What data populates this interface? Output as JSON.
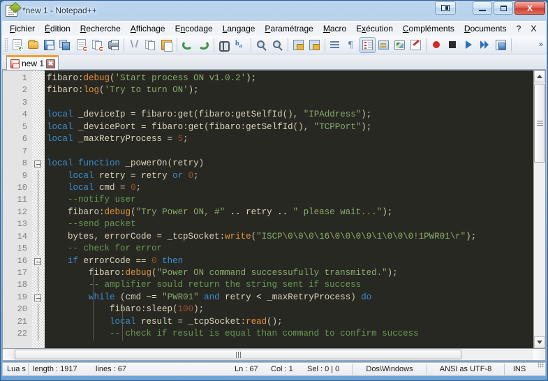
{
  "window": {
    "title": "*new  1 - Notepad++",
    "icon": "notepad-plus-plus-icon",
    "buttons": {
      "dual_view": "dual-view-icon",
      "minimize": "minimize-icon",
      "maximize": "maximize-icon",
      "close": "X"
    }
  },
  "menubar": {
    "items": [
      {
        "label": "Fichier",
        "accel": "F"
      },
      {
        "label": "Édition",
        "accel": "É"
      },
      {
        "label": "Recherche",
        "accel": "R"
      },
      {
        "label": "Affichage",
        "accel": "A"
      },
      {
        "label": "Encodage",
        "accel": "n"
      },
      {
        "label": "Langage",
        "accel": "L"
      },
      {
        "label": "Paramétrage",
        "accel": "P"
      },
      {
        "label": "Macro",
        "accel": "M"
      },
      {
        "label": "Exécution",
        "accel": "x"
      },
      {
        "label": "Compléments",
        "accel": "C"
      },
      {
        "label": "Documents",
        "accel": "D"
      },
      {
        "label": "?",
        "accel": "?"
      },
      {
        "label": "X",
        "accel": "X"
      }
    ]
  },
  "toolbar": {
    "overflow_label": "»",
    "buttons": [
      {
        "name": "new-file-icon",
        "title": "Nouveau"
      },
      {
        "name": "open-file-icon",
        "title": "Ouvrir"
      },
      {
        "name": "save-icon",
        "title": "Enregistrer"
      },
      {
        "name": "save-all-icon",
        "title": "Tout enregistrer"
      },
      {
        "name": "close-file-icon",
        "title": "Fermer"
      },
      {
        "name": "close-all-files-icon",
        "title": "Tout fermer"
      },
      {
        "name": "print-icon",
        "title": "Imprimer"
      },
      {
        "name": "cut-icon",
        "title": "Couper"
      },
      {
        "name": "copy-icon",
        "title": "Copier"
      },
      {
        "name": "paste-icon",
        "title": "Coller"
      },
      {
        "name": "undo-icon",
        "title": "Annuler"
      },
      {
        "name": "redo-icon",
        "title": "Refaire"
      },
      {
        "name": "find-icon",
        "title": "Rechercher"
      },
      {
        "name": "replace-icon",
        "title": "Remplacer"
      },
      {
        "name": "zoom-in-icon",
        "title": "Zoom avant"
      },
      {
        "name": "zoom-out-icon",
        "title": "Zoom arrière"
      },
      {
        "name": "sync-scroll-v-icon",
        "title": "Synchro verticale"
      },
      {
        "name": "sync-scroll-h-icon",
        "title": "Synchro horizontale"
      },
      {
        "name": "word-wrap-indent-icon",
        "title": "Indentation"
      },
      {
        "name": "pilcrow-icon",
        "title": "Marques de paragraphe"
      },
      {
        "name": "all-chars-icon",
        "title": "Afficher tous les caractères",
        "active": true
      },
      {
        "name": "wrap-lines-icon",
        "title": "Retour à la ligne"
      },
      {
        "name": "user-language-icon",
        "title": "Définition langage"
      },
      {
        "name": "doc-map-icon",
        "title": "Carte du document"
      },
      {
        "name": "record-macro-icon",
        "title": "Enregistrer macro"
      },
      {
        "name": "stop-macro-icon",
        "title": "Arrêter macro"
      },
      {
        "name": "play-macro-icon",
        "title": "Lancer macro"
      },
      {
        "name": "run-multi-macro-icon",
        "title": "Lancer plusieurs fois"
      },
      {
        "name": "save-macro-icon",
        "title": "Sauver macro"
      }
    ]
  },
  "tabs": [
    {
      "label": "new  1",
      "icon": "unsaved-file-icon",
      "close": "✖",
      "active": true
    }
  ],
  "editor": {
    "total_lines_visible": 22,
    "first_line": 1,
    "lines": [
      {
        "n": 1,
        "fold": "none",
        "guides": [],
        "tokens": [
          {
            "t": "fibaro",
            "c": "id"
          },
          {
            "t": ":",
            "c": "punc"
          },
          {
            "t": "debug",
            "c": "fn"
          },
          {
            "t": "(",
            "c": "punc"
          },
          {
            "t": "'Start process ON v1.0.2'",
            "c": "str"
          },
          {
            "t": ")",
            "c": "punc"
          },
          {
            "t": ";",
            "c": "punc"
          }
        ]
      },
      {
        "n": 2,
        "fold": "none",
        "guides": [],
        "tokens": [
          {
            "t": "fibaro",
            "c": "id"
          },
          {
            "t": ":",
            "c": "punc"
          },
          {
            "t": "log",
            "c": "fn"
          },
          {
            "t": "(",
            "c": "punc"
          },
          {
            "t": "'Try to turn ON'",
            "c": "str"
          },
          {
            "t": ")",
            "c": "punc"
          },
          {
            "t": ";",
            "c": "punc"
          }
        ]
      },
      {
        "n": 3,
        "fold": "none",
        "guides": [],
        "tokens": []
      },
      {
        "n": 4,
        "fold": "none",
        "guides": [],
        "tokens": [
          {
            "t": "local",
            "c": "kw"
          },
          {
            "t": " _deviceIp ",
            "c": "id"
          },
          {
            "t": "=",
            "c": "op"
          },
          {
            "t": " fibaro",
            "c": "id"
          },
          {
            "t": ":",
            "c": "punc"
          },
          {
            "t": "get",
            "c": "id"
          },
          {
            "t": "(",
            "c": "punc"
          },
          {
            "t": "fibaro",
            "c": "id"
          },
          {
            "t": ":",
            "c": "punc"
          },
          {
            "t": "getSelfId",
            "c": "id"
          },
          {
            "t": "()",
            "c": "punc"
          },
          {
            "t": ", ",
            "c": "punc"
          },
          {
            "t": "\"IPAddress\"",
            "c": "str"
          },
          {
            "t": ")",
            "c": "punc"
          },
          {
            "t": ";",
            "c": "punc"
          }
        ]
      },
      {
        "n": 5,
        "fold": "none",
        "guides": [],
        "tokens": [
          {
            "t": "local",
            "c": "kw"
          },
          {
            "t": " _devicePort ",
            "c": "id"
          },
          {
            "t": "=",
            "c": "op"
          },
          {
            "t": " fibaro",
            "c": "id"
          },
          {
            "t": ":",
            "c": "punc"
          },
          {
            "t": "get",
            "c": "id"
          },
          {
            "t": "(",
            "c": "punc"
          },
          {
            "t": "fibaro",
            "c": "id"
          },
          {
            "t": ":",
            "c": "punc"
          },
          {
            "t": "getSelfId",
            "c": "id"
          },
          {
            "t": "()",
            "c": "punc"
          },
          {
            "t": ", ",
            "c": "punc"
          },
          {
            "t": "\"TCPPort\"",
            "c": "str"
          },
          {
            "t": ")",
            "c": "punc"
          },
          {
            "t": ";",
            "c": "punc"
          }
        ]
      },
      {
        "n": 6,
        "fold": "none",
        "guides": [],
        "tokens": [
          {
            "t": "local",
            "c": "kw"
          },
          {
            "t": " _maxRetryProcess ",
            "c": "id"
          },
          {
            "t": "=",
            "c": "op"
          },
          {
            "t": " ",
            "c": "id"
          },
          {
            "t": "5",
            "c": "num"
          },
          {
            "t": ";",
            "c": "punc"
          }
        ]
      },
      {
        "n": 7,
        "fold": "none",
        "guides": [],
        "tokens": []
      },
      {
        "n": 8,
        "fold": "open",
        "guides": [],
        "tokens": [
          {
            "t": "local",
            "c": "kw"
          },
          {
            "t": " ",
            "c": "id"
          },
          {
            "t": "function",
            "c": "kw"
          },
          {
            "t": " _powerOn",
            "c": "id"
          },
          {
            "t": "(",
            "c": "punc"
          },
          {
            "t": "retry",
            "c": "id"
          },
          {
            "t": ")",
            "c": "punc"
          }
        ]
      },
      {
        "n": 9,
        "fold": "line",
        "guides": [],
        "tokens": [
          {
            "t": "    ",
            "c": "id"
          },
          {
            "t": "local",
            "c": "kw"
          },
          {
            "t": " retry ",
            "c": "id"
          },
          {
            "t": "=",
            "c": "op"
          },
          {
            "t": " retry ",
            "c": "id"
          },
          {
            "t": "or",
            "c": "kw"
          },
          {
            "t": " ",
            "c": "id"
          },
          {
            "t": "0",
            "c": "num"
          },
          {
            "t": ";",
            "c": "punc"
          }
        ]
      },
      {
        "n": 10,
        "fold": "line",
        "guides": [],
        "tokens": [
          {
            "t": "    ",
            "c": "id"
          },
          {
            "t": "local",
            "c": "kw"
          },
          {
            "t": " cmd ",
            "c": "id"
          },
          {
            "t": "=",
            "c": "op"
          },
          {
            "t": " ",
            "c": "id"
          },
          {
            "t": "0",
            "c": "num"
          },
          {
            "t": ";",
            "c": "punc"
          }
        ]
      },
      {
        "n": 11,
        "fold": "line",
        "guides": [],
        "tokens": [
          {
            "t": "    ",
            "c": "id"
          },
          {
            "t": "--notify user",
            "c": "com"
          }
        ]
      },
      {
        "n": 12,
        "fold": "line",
        "guides": [],
        "tokens": [
          {
            "t": "    ",
            "c": "id"
          },
          {
            "t": "fibaro",
            "c": "id"
          },
          {
            "t": ":",
            "c": "punc"
          },
          {
            "t": "debug",
            "c": "fn"
          },
          {
            "t": "(",
            "c": "punc"
          },
          {
            "t": "\"Try Power ON, #\"",
            "c": "str"
          },
          {
            "t": " .. ",
            "c": "op"
          },
          {
            "t": "retry",
            "c": "id"
          },
          {
            "t": " .. ",
            "c": "op"
          },
          {
            "t": "\" please wait...\"",
            "c": "str"
          },
          {
            "t": ")",
            "c": "punc"
          },
          {
            "t": ";",
            "c": "punc"
          }
        ]
      },
      {
        "n": 13,
        "fold": "line",
        "guides": [],
        "tokens": [
          {
            "t": "    ",
            "c": "id"
          },
          {
            "t": "--send packet",
            "c": "com"
          }
        ]
      },
      {
        "n": 14,
        "fold": "line",
        "guides": [],
        "tokens": [
          {
            "t": "    bytes, errorCode ",
            "c": "id"
          },
          {
            "t": "=",
            "c": "op"
          },
          {
            "t": " _tcpSocket",
            "c": "id"
          },
          {
            "t": ":",
            "c": "punc"
          },
          {
            "t": "write",
            "c": "fn"
          },
          {
            "t": "(",
            "c": "punc"
          },
          {
            "t": "\"ISCP\\0\\0\\0\\16\\0\\0\\0\\9\\1\\0\\0\\0!1PWR01\\r\"",
            "c": "str"
          },
          {
            "t": ")",
            "c": "punc"
          },
          {
            "t": ";",
            "c": "punc"
          }
        ]
      },
      {
        "n": 15,
        "fold": "line",
        "guides": [],
        "tokens": [
          {
            "t": "    ",
            "c": "id"
          },
          {
            "t": "-- check for error",
            "c": "com"
          }
        ]
      },
      {
        "n": 16,
        "fold": "open",
        "guides": [],
        "tokens": [
          {
            "t": "    ",
            "c": "id"
          },
          {
            "t": "if",
            "c": "kw"
          },
          {
            "t": " errorCode ",
            "c": "id"
          },
          {
            "t": "==",
            "c": "op"
          },
          {
            "t": " ",
            "c": "id"
          },
          {
            "t": "0",
            "c": "num"
          },
          {
            "t": " ",
            "c": "id"
          },
          {
            "t": "then",
            "c": "kw"
          }
        ]
      },
      {
        "n": 17,
        "fold": "line",
        "guides": [
          66
        ],
        "tokens": [
          {
            "t": "        ",
            "c": "id"
          },
          {
            "t": "fibaro",
            "c": "id"
          },
          {
            "t": ":",
            "c": "punc"
          },
          {
            "t": "debug",
            "c": "fn"
          },
          {
            "t": "(",
            "c": "punc"
          },
          {
            "t": "\"Power ON command successufully transmited.\"",
            "c": "str"
          },
          {
            "t": ")",
            "c": "punc"
          },
          {
            "t": ";",
            "c": "punc"
          }
        ]
      },
      {
        "n": 18,
        "fold": "line",
        "guides": [
          66
        ],
        "tokens": [
          {
            "t": "        ",
            "c": "id"
          },
          {
            "t": "-- amplifier sould return the string sent if success",
            "c": "com"
          }
        ]
      },
      {
        "n": 19,
        "fold": "open",
        "guides": [
          66
        ],
        "tokens": [
          {
            "t": "        ",
            "c": "id"
          },
          {
            "t": "while",
            "c": "kw"
          },
          {
            "t": " ",
            "c": "id"
          },
          {
            "t": "(",
            "c": "punc"
          },
          {
            "t": "cmd ",
            "c": "id"
          },
          {
            "t": "~=",
            "c": "op"
          },
          {
            "t": " ",
            "c": "id"
          },
          {
            "t": "\"PWR01\"",
            "c": "str"
          },
          {
            "t": " ",
            "c": "id"
          },
          {
            "t": "and",
            "c": "kw"
          },
          {
            "t": " retry ",
            "c": "id"
          },
          {
            "t": "<",
            "c": "op"
          },
          {
            "t": " _maxRetryProcess",
            "c": "id"
          },
          {
            "t": ")",
            "c": "punc"
          },
          {
            "t": " ",
            "c": "id"
          },
          {
            "t": "do",
            "c": "kw"
          }
        ]
      },
      {
        "n": 20,
        "fold": "line",
        "guides": [
          66,
          108
        ],
        "tokens": [
          {
            "t": "            ",
            "c": "id"
          },
          {
            "t": "fibaro",
            "c": "id"
          },
          {
            "t": ":",
            "c": "punc"
          },
          {
            "t": "sleep",
            "c": "id"
          },
          {
            "t": "(",
            "c": "punc"
          },
          {
            "t": "100",
            "c": "num"
          },
          {
            "t": ")",
            "c": "punc"
          },
          {
            "t": ";",
            "c": "punc"
          }
        ]
      },
      {
        "n": 21,
        "fold": "line",
        "guides": [
          66,
          108
        ],
        "tokens": [
          {
            "t": "            ",
            "c": "id"
          },
          {
            "t": "local",
            "c": "kw"
          },
          {
            "t": " result ",
            "c": "id"
          },
          {
            "t": "=",
            "c": "op"
          },
          {
            "t": " _tcpSocket",
            "c": "id"
          },
          {
            "t": ":",
            "c": "punc"
          },
          {
            "t": "read",
            "c": "fn"
          },
          {
            "t": "()",
            "c": "punc"
          },
          {
            "t": ";",
            "c": "punc"
          }
        ]
      },
      {
        "n": 22,
        "fold": "line",
        "guides": [
          66,
          108
        ],
        "tokens": [
          {
            "t": "            ",
            "c": "id"
          },
          {
            "t": "-- check if result is equal than command to confirm success",
            "c": "com"
          }
        ]
      }
    ],
    "colors": {
      "background": "#272822",
      "foreground": "#f8f8f2",
      "keyword": "#3a8fd4",
      "function": "#e69138",
      "string": "#8bab6d",
      "number": "#a0522d",
      "comment": "#6a9955",
      "gutter_bg": "#e4e4e4",
      "gutter_fg": "#808080"
    }
  },
  "scrollbars": {
    "vertical": {
      "up": "scroll-up-arrow",
      "down": "scroll-down-arrow"
    },
    "horizontal": {
      "left": "scroll-left-arrow",
      "right": "scroll-right-arrow"
    }
  },
  "statusbar": {
    "language": "Lua s",
    "length_label": "length : 1917",
    "lines_label": "lines : 67",
    "ln": "Ln : 67",
    "col": "Col : 1",
    "sel": "Sel : 0 | 0",
    "eol": "Dos\\Windows",
    "encoding": "ANSI as UTF-8",
    "insert_mode": "INS"
  }
}
